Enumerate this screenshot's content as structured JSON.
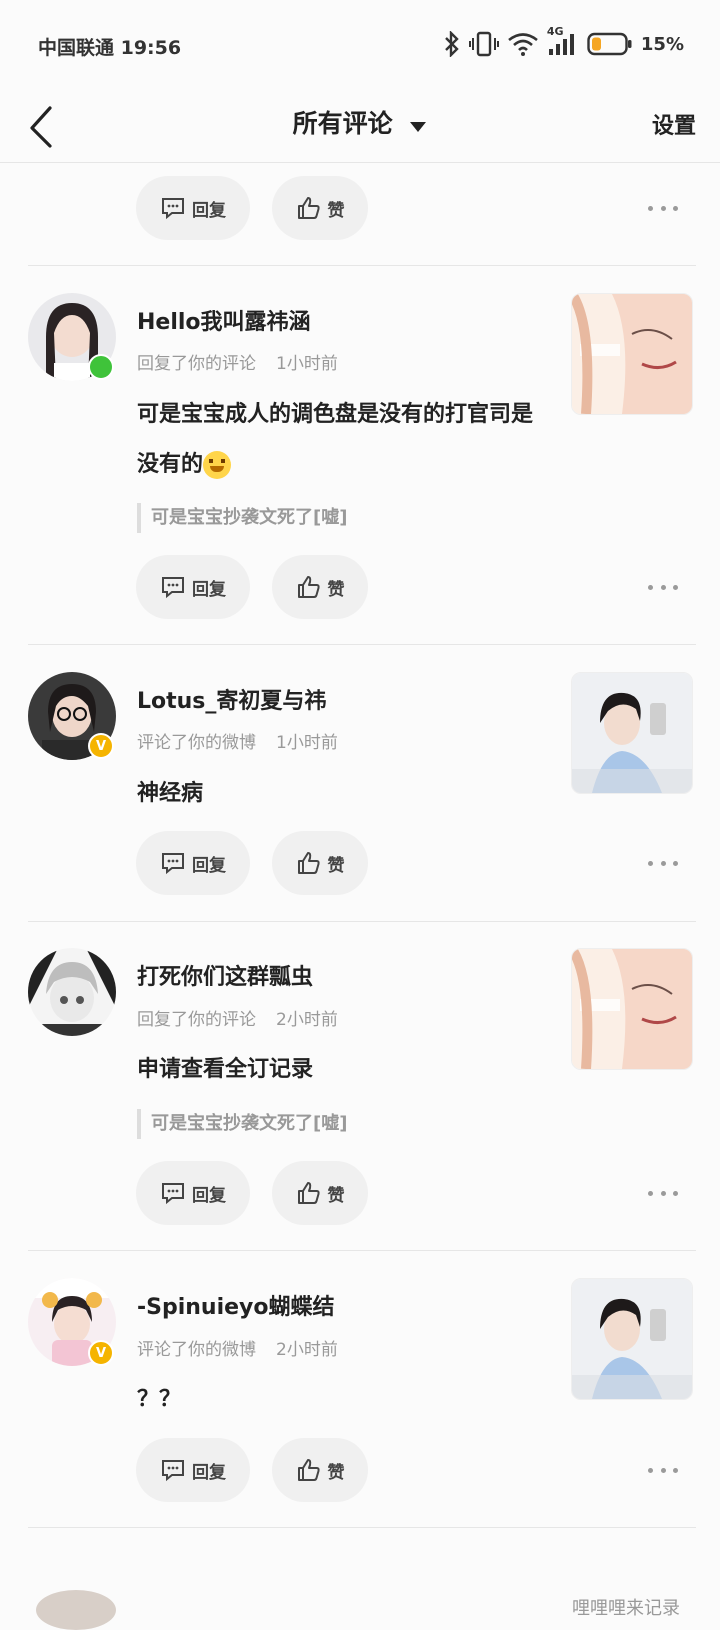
{
  "status_bar": {
    "carrier_time": "中国联通 19:56",
    "network": "4G",
    "battery": "15%"
  },
  "header": {
    "title": "所有评论",
    "settings_label": "设置"
  },
  "actions": {
    "reply_label": "回复",
    "like_label": "赞"
  },
  "comments": [
    {
      "username": "Hello我叫露祎涵",
      "action": "回复了你的评论",
      "time": "1小时前",
      "content": "可是宝宝成人的调色盘是没有的打官司是没有的",
      "quote": "可是宝宝抄袭文死了[嘘]",
      "badge": "online"
    },
    {
      "username": "Lotus_寄初夏与祎",
      "action": "评论了你的微博",
      "time": "1小时前",
      "content": "神经病",
      "badge": "vip"
    },
    {
      "username": "打死你们这群瓢虫",
      "action": "回复了你的评论",
      "time": "2小时前",
      "content": "申请查看全订记录",
      "quote": "可是宝宝抄袭文死了[嘘]"
    },
    {
      "username": "-Spinuieyo蝴蝶结",
      "action": "评论了你的微博",
      "time": "2小时前",
      "content": "？？",
      "badge": "vip"
    }
  ],
  "footer_peek_text": "哩哩哩来记录"
}
